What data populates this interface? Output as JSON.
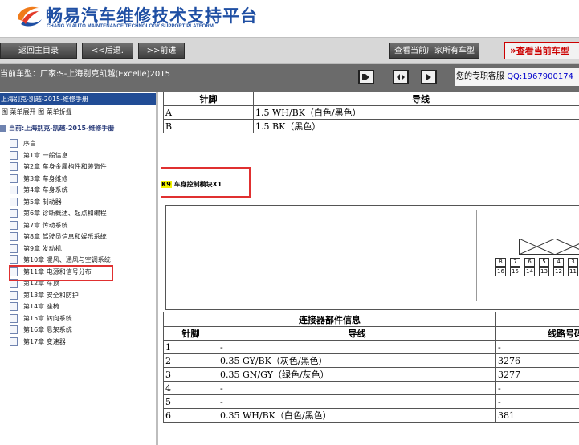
{
  "header": {
    "title": "畅易汽车维修技术支持平台",
    "subtitle": "CHANG YI AUTO MAINTENANCE TECHNOLOGY SUPPORT PLATFORM"
  },
  "toolbar": {
    "home_label": "返回主目录",
    "back_label": "<<后退.",
    "forward_label": ">>前进",
    "all_models_label": "查看当前厂家所有车型",
    "current_model_label": "查看当前车型"
  },
  "infobar": {
    "current_model": "当前车型：厂家:S-上海别克凯越(Excelle)2015",
    "support_text": "您的专职客服",
    "support_qq": "QQ:1967900174"
  },
  "sidebar": {
    "manual_title": "上海别克-凯越-2015-维修手册",
    "tree_controls": "图 菜单展开  图 菜单折叠",
    "current": "当前:上海别克-凯越-2015-维修手册",
    "items": [
      {
        "label": "序言"
      },
      {
        "label": "第1章 一般信息"
      },
      {
        "label": "第2章 车身金属构件和装饰件"
      },
      {
        "label": "第3章 车身维修"
      },
      {
        "label": "第4章 车身系统"
      },
      {
        "label": "第5章 制动器"
      },
      {
        "label": "第6章 诊断概述、起点和编程"
      },
      {
        "label": "第7章 传动系统"
      },
      {
        "label": "第8章 驾驶员信息和娱乐系统"
      },
      {
        "label": "第9章 发动机"
      },
      {
        "label": "第10章 暖风、通风与空调系统"
      },
      {
        "label": "第11章 电源和信号分布"
      },
      {
        "label": "第12章 车顶"
      },
      {
        "label": "第13章 安全和防护"
      },
      {
        "label": "第14章 座椅"
      },
      {
        "label": "第15章 转向系统"
      },
      {
        "label": "第16章 悬架系统"
      },
      {
        "label": "第17章 变速器"
      }
    ]
  },
  "top_table": {
    "headers": [
      "针脚",
      "导线"
    ],
    "rows": [
      [
        "A",
        "1.5 WH/BK（白色/黑色）"
      ],
      [
        "B",
        "1.5 BK（黑色）"
      ]
    ]
  },
  "connector": {
    "code": "K9",
    "name": "车身控制模块X1"
  },
  "pinout": {
    "row1": [
      "8",
      "7",
      "6",
      "5",
      "4",
      "3"
    ],
    "row2": [
      "16",
      "15",
      "14",
      "13",
      "12",
      "11"
    ]
  },
  "info_table": {
    "section_title": "连接器部件信息",
    "headers": [
      "针脚",
      "导线",
      "线路号码"
    ],
    "rows": [
      [
        "1",
        "-",
        "-"
      ],
      [
        "2",
        "0.35 GY/BK（灰色/黑色）",
        "3276"
      ],
      [
        "3",
        "0.35 GN/GY（绿色/灰色）",
        "3277"
      ],
      [
        "4",
        "-",
        "-"
      ],
      [
        "5",
        "-",
        "-"
      ],
      [
        "6",
        "0.35 WH/BK（白色/黑色）",
        "381"
      ]
    ]
  },
  "colors": {
    "brand_blue": "#1f4fa3",
    "toolbar_bg": "#d7d7d7",
    "infobar_bg": "#6b6b6b",
    "highlight_red": "#e03030",
    "connector_code_bg": "#f3f300"
  }
}
